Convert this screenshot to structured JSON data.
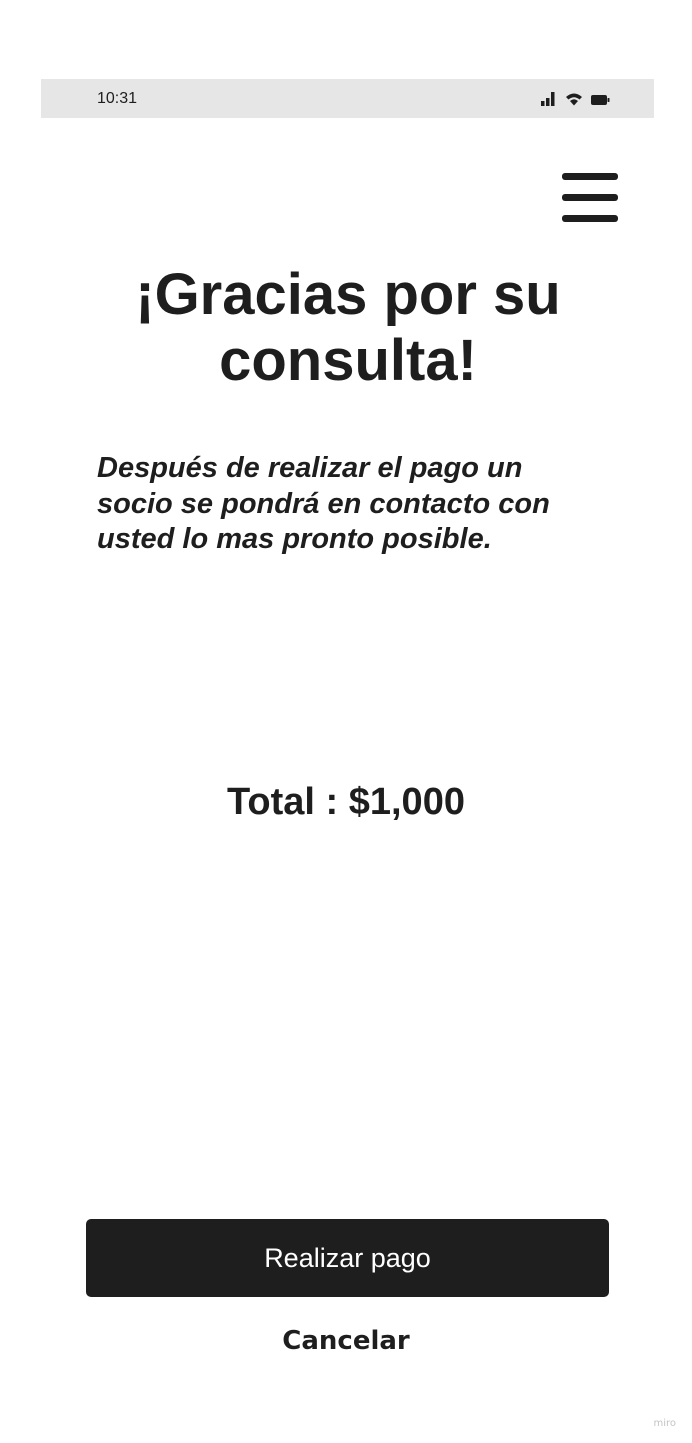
{
  "status_bar": {
    "time": "10:31",
    "icons": [
      "signal-icon",
      "wifi-icon",
      "battery-icon"
    ]
  },
  "header": {
    "menu_icon": "hamburger-menu-icon"
  },
  "main": {
    "title": "¡Gracias por su consulta!",
    "message": "Después de realizar el pago un socio se pondrá en contacto con usted lo mas pronto posible.",
    "total": "Total : $1,000"
  },
  "actions": {
    "pay_label": "Realizar pago",
    "cancel_label": "Cancelar"
  },
  "watermark": "miro",
  "colors": {
    "primary": "#1e1e1e",
    "status_bar_bg": "#e6e6e6",
    "background": "#ffffff",
    "button_text": "#ffffff"
  }
}
